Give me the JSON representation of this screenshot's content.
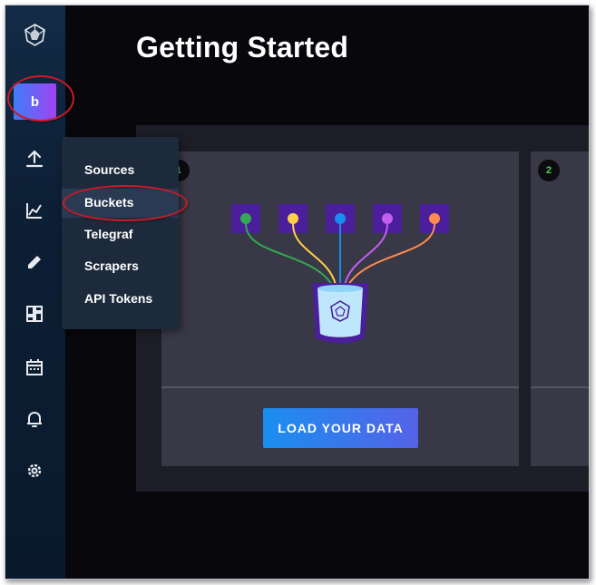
{
  "page": {
    "title": "Getting Started"
  },
  "sidebar": {
    "avatar_initial": "b",
    "nav_icons": [
      "upload-icon",
      "graph-icon",
      "pencil-icon",
      "dashboard-icon",
      "calendar-icon",
      "bell-icon",
      "gear-icon"
    ]
  },
  "load_menu": {
    "items": [
      "Sources",
      "Buckets",
      "Telegraf",
      "Scrapers",
      "API Tokens"
    ],
    "highlighted": "Buckets"
  },
  "steps": [
    {
      "number": "1",
      "button_label": "LOAD YOUR DATA"
    },
    {
      "number": "2"
    }
  ],
  "colors": {
    "accent_blue": "#1a8ef0",
    "accent_purple": "#5562e8",
    "step_number": "#4ad25a",
    "annotation_ring": "#cc1a26",
    "dot_colors": [
      "#34a853",
      "#ffcf4a",
      "#1a8ef0",
      "#c35ef0",
      "#ff8b4e"
    ]
  }
}
